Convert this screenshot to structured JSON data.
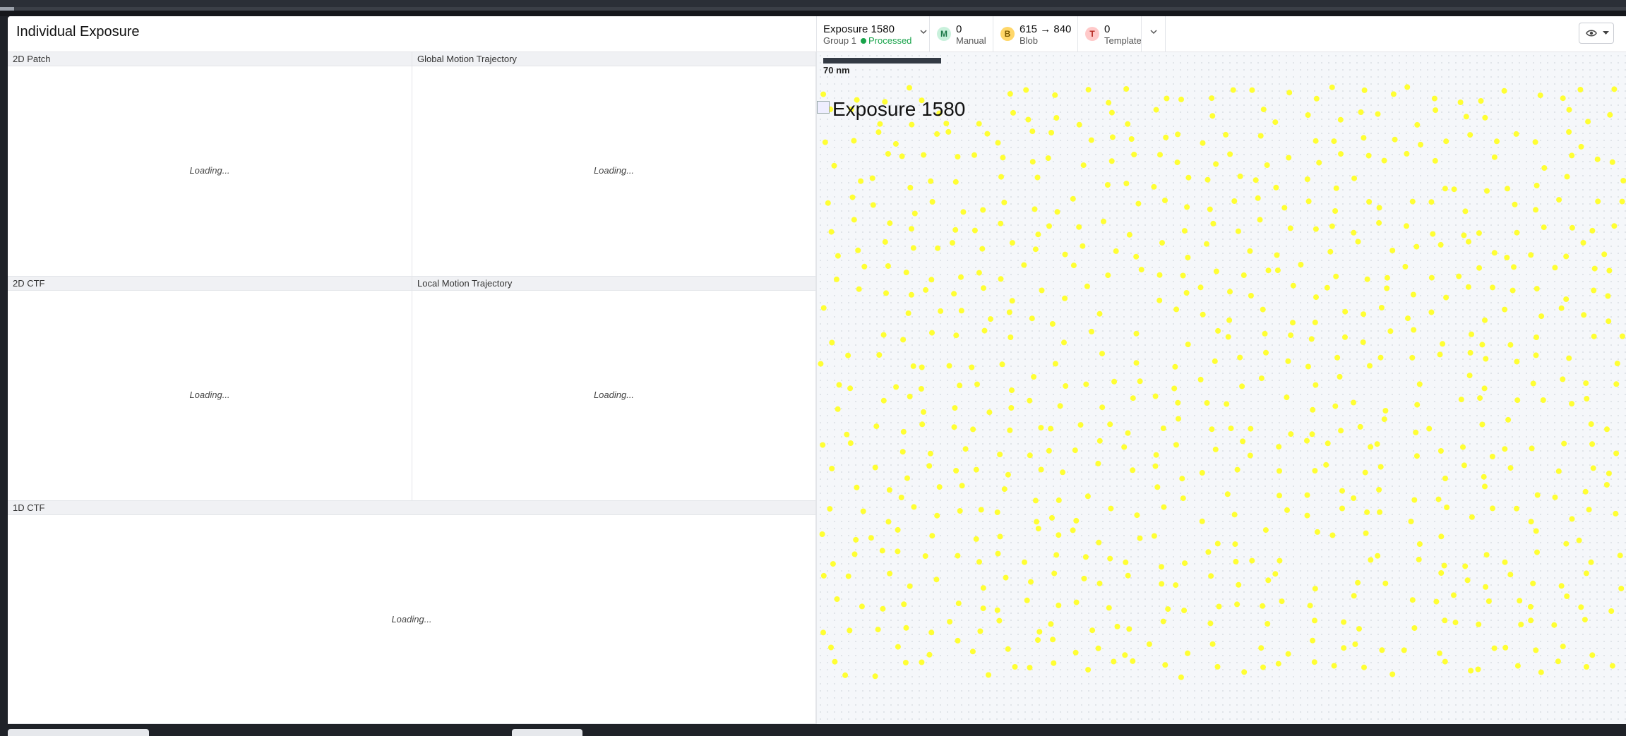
{
  "header": {
    "title": "Individual Exposure",
    "exposure": {
      "name": "Exposure 1580",
      "group": "Group 1",
      "status": "Processed"
    },
    "pickers": [
      {
        "badge": "M",
        "count": "0",
        "label": "Manual",
        "badge_bg": "#c9f1dc",
        "badge_fg": "#1f7a4a"
      },
      {
        "badge": "B",
        "count": "615 → 840",
        "label": "Blob",
        "badge_bg": "#ffd769",
        "badge_fg": "#7a5800"
      },
      {
        "badge": "T",
        "count": "0",
        "label": "Template",
        "badge_bg": "#ffc9c9",
        "badge_fg": "#b3261e"
      }
    ],
    "icons": {
      "exposure_dropdown": "chevron-down-icon",
      "pickers_dropdown": "chevron-down-icon",
      "view_toggle": "eye-icon"
    }
  },
  "panels": {
    "patch2d": {
      "title": "2D Patch",
      "status": "Loading..."
    },
    "global_motion": {
      "title": "Global Motion Trajectory",
      "status": "Loading..."
    },
    "ctf2d": {
      "title": "2D CTF",
      "status": "Loading..."
    },
    "local_motion": {
      "title": "Local Motion Trajectory",
      "status": "Loading..."
    },
    "ctf1d": {
      "title": "1D CTF",
      "status": "Loading..."
    }
  },
  "micrograph": {
    "scale_label": "70 nm",
    "image_alt": "Exposure 1580",
    "particle_color": "#ffff33",
    "particle_count": 840
  },
  "colors": {
    "status_green": "#17a34a",
    "accent_dark": "#333a44"
  }
}
